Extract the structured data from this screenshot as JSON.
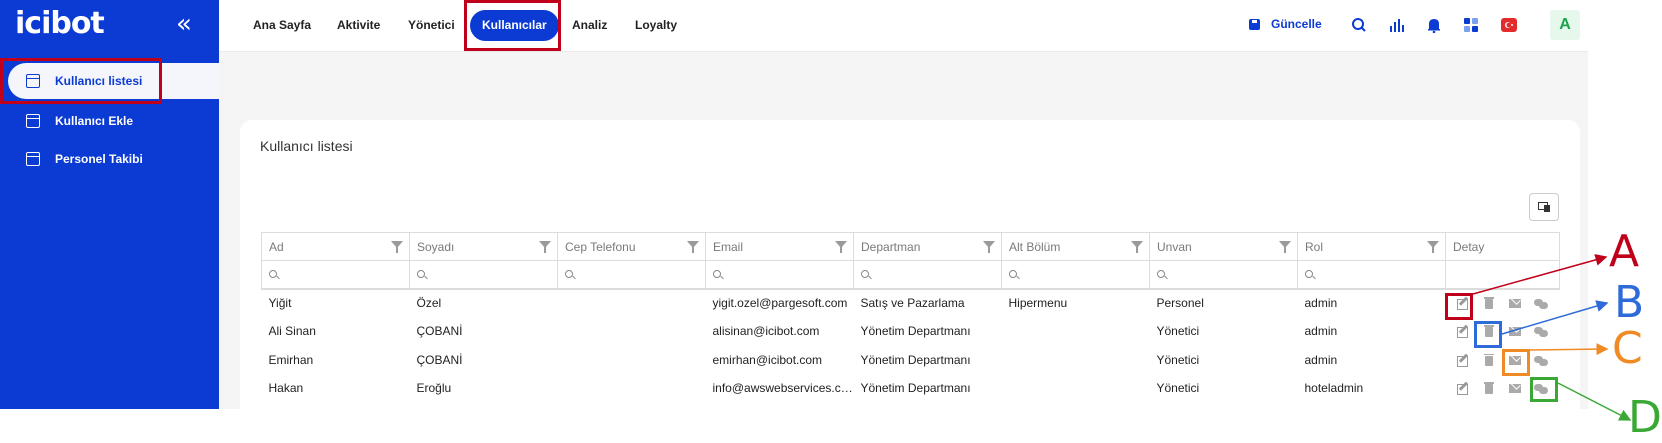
{
  "app": {
    "logo": "icibot",
    "collapse_glyph": "«"
  },
  "sidebar": {
    "items": [
      {
        "label": "Kullanıcı listesi",
        "icon": "table-icon",
        "active": true
      },
      {
        "label": "Kullanıcı Ekle",
        "icon": "table-icon",
        "active": false
      },
      {
        "label": "Personel Takibi",
        "icon": "table-icon",
        "active": false
      }
    ]
  },
  "topnav": {
    "items": [
      {
        "label": "Ana Sayfa",
        "active": false
      },
      {
        "label": "Aktivite",
        "active": false
      },
      {
        "label": "Yönetici",
        "active": false
      },
      {
        "label": "Kullanıcılar",
        "active": true
      },
      {
        "label": "Analiz",
        "active": false
      },
      {
        "label": "Loyalty",
        "active": false
      }
    ],
    "refresh_label": "Güncelle",
    "avatar_initial": "A",
    "icons": [
      "save-icon",
      "search-icon",
      "bar-chart-icon",
      "bell-icon",
      "apps-grid-icon",
      "turkey-flag-icon"
    ]
  },
  "card": {
    "title": "Kullanıcı listesi"
  },
  "table": {
    "columns": [
      "Ad",
      "Soyadı",
      "Cep Telefonu",
      "Email",
      "Departman",
      "Alt Bölüm",
      "Unvan",
      "Rol",
      "Detay"
    ],
    "rows": [
      [
        "Yiğit",
        "Özel",
        "",
        "yigit.ozel@pargesoft.com",
        "Satış ve Pazarlama",
        "Hipermenu",
        "Personel",
        "admin"
      ],
      [
        "Ali Sinan",
        "ÇOBANİ",
        "",
        "alisinan@icibot.com",
        "Yönetim Departmanı",
        "",
        "Yönetici",
        "admin"
      ],
      [
        "Emirhan",
        "ÇOBANİ",
        "",
        "emirhan@icibot.com",
        "Yönetim Departmanı",
        "",
        "Yönetici",
        "admin"
      ],
      [
        "Hakan",
        "Eroğlu",
        "",
        "info@awswebservices.com",
        "Yönetim Departmanı",
        "",
        "Yönetici",
        "hoteladmin"
      ]
    ],
    "row_actions": [
      "edit-icon",
      "delete-icon",
      "mail-icon",
      "chat-icon"
    ]
  },
  "annotations": {
    "labels": [
      "A",
      "B",
      "C",
      "D"
    ],
    "colors": {
      "A": "#c0001a",
      "B": "#2f6bd8",
      "C": "#f08a24",
      "D": "#3aa835",
      "frame": "#c0001a"
    }
  },
  "colors": {
    "brand": "#0b3bd3",
    "background": "#f5f5f5"
  }
}
